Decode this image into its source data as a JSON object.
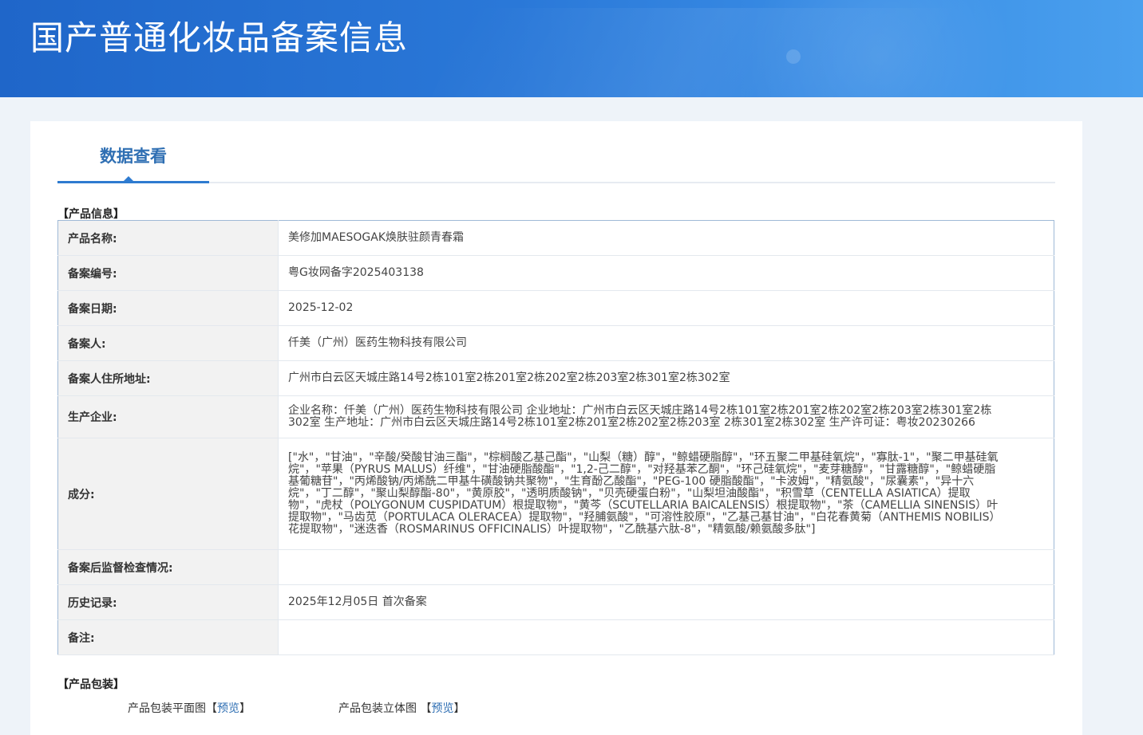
{
  "header": {
    "title": "国产普通化妆品备案信息"
  },
  "tabs": {
    "active_label": "数据查看"
  },
  "product_info": {
    "section_title": "【产品信息】",
    "rows": [
      {
        "label": "产品名称:",
        "value": "美修加MAESOGAK焕肤驻颜青春霜"
      },
      {
        "label": "备案编号:",
        "value": "粤G妆网备字2025403138"
      },
      {
        "label": "备案日期:",
        "value": "2025-12-02"
      },
      {
        "label": "备案人:",
        "value": "仟美（广州）医药生物科技有限公司"
      },
      {
        "label": "备案人住所地址:",
        "value": "广州市白云区天城庄路14号2栋101室2栋201室2栋202室2栋203室2栋301室2栋302室"
      },
      {
        "label": "生产企业:",
        "value": "企业名称：仟美（广州）医药生物科技有限公司 企业地址：广州市白云区天城庄路14号2栋101室2栋201室2栋202室2栋203室2栋301室2栋302室 生产地址：广州市白云区天城庄路14号2栋101室2栋201室2栋202室2栋203室 2栋301室2栋302室 生产许可证：粤妆20230266"
      },
      {
        "label": "成分:",
        "value": "[\"水\"，\"甘油\"，\"辛酸/癸酸甘油三酯\"，\"棕榈酸乙基己酯\"，\"山梨（糖）醇\"，\"鲸蜡硬脂醇\"，\"环五聚二甲基硅氧烷\"，\"寡肽-1\"，\"聚二甲基硅氧烷\"，\"苹果（PYRUS MALUS）纤维\"，\"甘油硬脂酸酯\"，\"1,2-己二醇\"，\"对羟基苯乙酮\"，\"环己硅氧烷\"，\"麦芽糖醇\"，\"甘露糖醇\"，\"鲸蜡硬脂基葡糖苷\"，\"丙烯酸钠/丙烯酰二甲基牛磺酸钠共聚物\"，\"生育酚乙酸酯\"，\"PEG-100 硬脂酸酯\"，\"卡波姆\"，\"精氨酸\"，\"尿囊素\"，\"异十六烷\"，\"丁二醇\"，\"聚山梨醇酯-80\"，\"黄原胶\"，\"透明质酸钠\"，\"贝壳硬蛋白粉\"，\"山梨坦油酸酯\"，\"积雪草（CENTELLA ASIATICA）提取物\"，\"虎杖（POLYGONUM CUSPIDATUM）根提取物\"，\"黄芩（SCUTELLARIA BAICALENSIS）根提取物\"，\"茶（CAMELLIA SINENSIS）叶提取物\"，\"马齿苋（PORTULACA OLERACEA）提取物\"，\"羟脯氨酸\"，\"可溶性胶原\"，\"乙基己基甘油\"，\"白花春黄菊（ANTHEMIS NOBILIS）花提取物\"，\"迷迭香（ROSMARINUS OFFICINALIS）叶提取物\"，\"乙酰基六肽-8\"，\"精氨酸/赖氨酸多肽\"]"
      },
      {
        "label": "备案后监督检查情况:",
        "value": ""
      },
      {
        "label": "历史记录:",
        "value": "2025年12月05日 首次备案"
      },
      {
        "label": "备注:",
        "value": ""
      }
    ]
  },
  "packaging": {
    "section_title": "【产品包装】",
    "flat_label": "产品包装平面图",
    "stereo_label": "产品包装立体图",
    "preview_label": "预览",
    "bracket_open": "【",
    "bracket_close": "】"
  }
}
